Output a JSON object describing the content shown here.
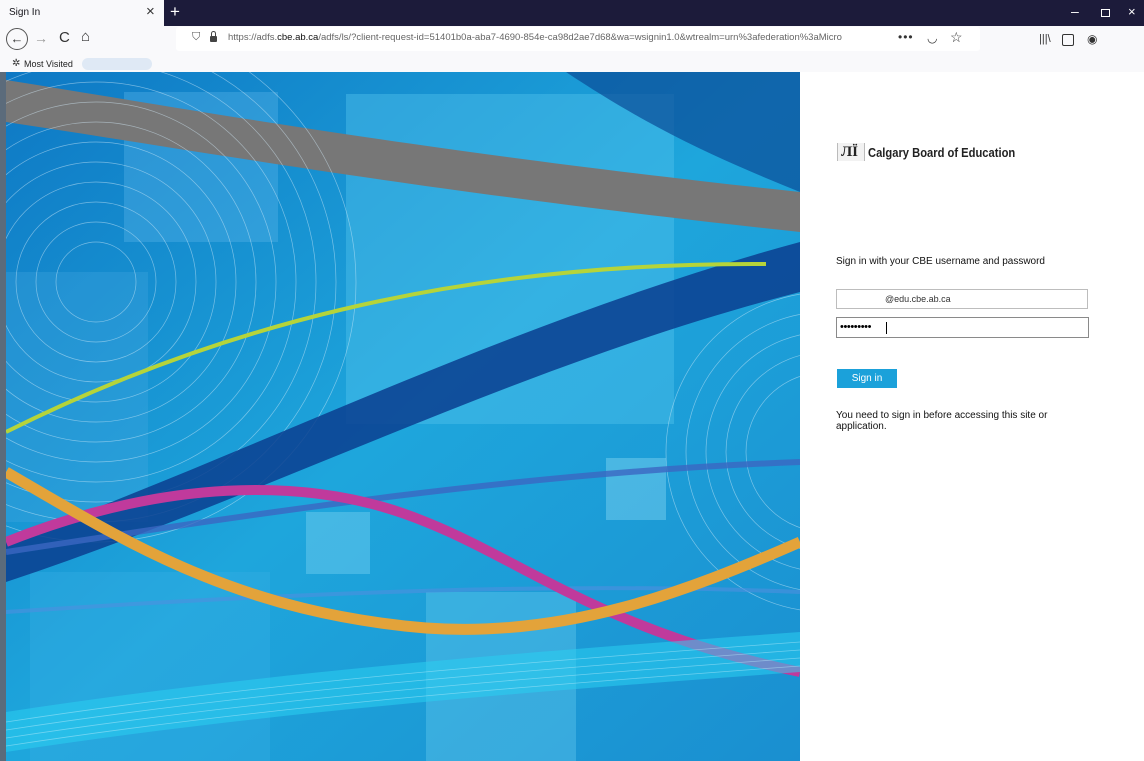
{
  "browser": {
    "tab_title": "Sign In",
    "tab_close": "×",
    "new_tab": "+",
    "window_minimize": "–",
    "window_close": "×",
    "nav": {
      "back": "←",
      "forward": "→",
      "reload": "C",
      "home": "⌂"
    },
    "url_prefix": "https://adfs.",
    "url_domain": "cbe.ab.ca",
    "url_suffix": "/adfs/ls/?client-request-id=51401b0a-aba7-4690-854e-ca98d2ae7d68&wa=wsignin1.0&wtrealm=urn%3afederation%3aMicro",
    "toolbar_dots": "•••",
    "bookmark_label": "Most Visited",
    "icons": [
      "shield-icon",
      "lock-icon",
      "pocket-icon",
      "star-icon",
      "library-icon",
      "sidebar-icon",
      "account-icon",
      "gear-icon"
    ]
  },
  "signin": {
    "logo_mark": "ЛЇ",
    "org_name": "Calgary Board of Education",
    "heading": "Sign in with your CBE username and password",
    "username_value": "@edu.cbe.ab.ca",
    "password_value": "•••••••••",
    "button_label": "Sign in",
    "notice": "You need to sign in before accessing this site or application.",
    "accent_color": "#1ba1da"
  }
}
